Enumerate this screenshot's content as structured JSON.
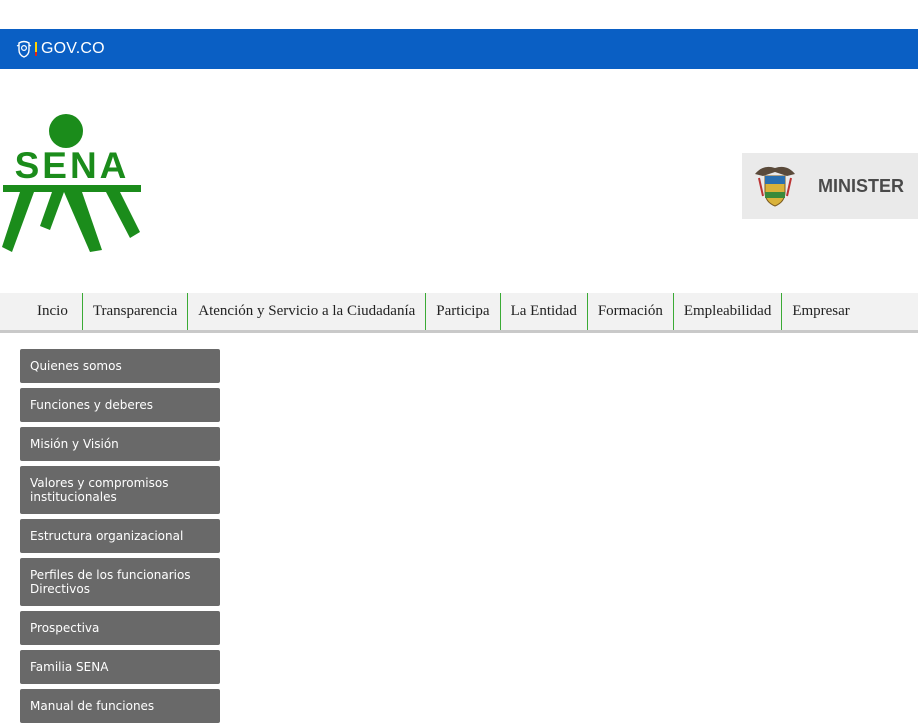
{
  "govbar": {
    "brand_text": "GOV.CO",
    "color": "#0a5fc4"
  },
  "header": {
    "logo_text": "SENA",
    "logo_color": "#1b8c1b",
    "ministry_text": "MINISTER"
  },
  "nav": {
    "items": [
      "Incio",
      "Transparencia",
      "Atención y Servicio a la Ciudadanía",
      "Participa",
      "La Entidad",
      "Formación",
      "Empleabilidad",
      "Empresar"
    ]
  },
  "sidebar": {
    "items": [
      "Quienes somos",
      "Funciones y deberes",
      "Misión y Visión",
      "Valores y compromisos institucionales",
      "Estructura organizacional",
      "Perfiles de los funcionarios Directivos",
      "Prospectiva",
      "Familia SENA",
      "Manual de funciones"
    ]
  }
}
